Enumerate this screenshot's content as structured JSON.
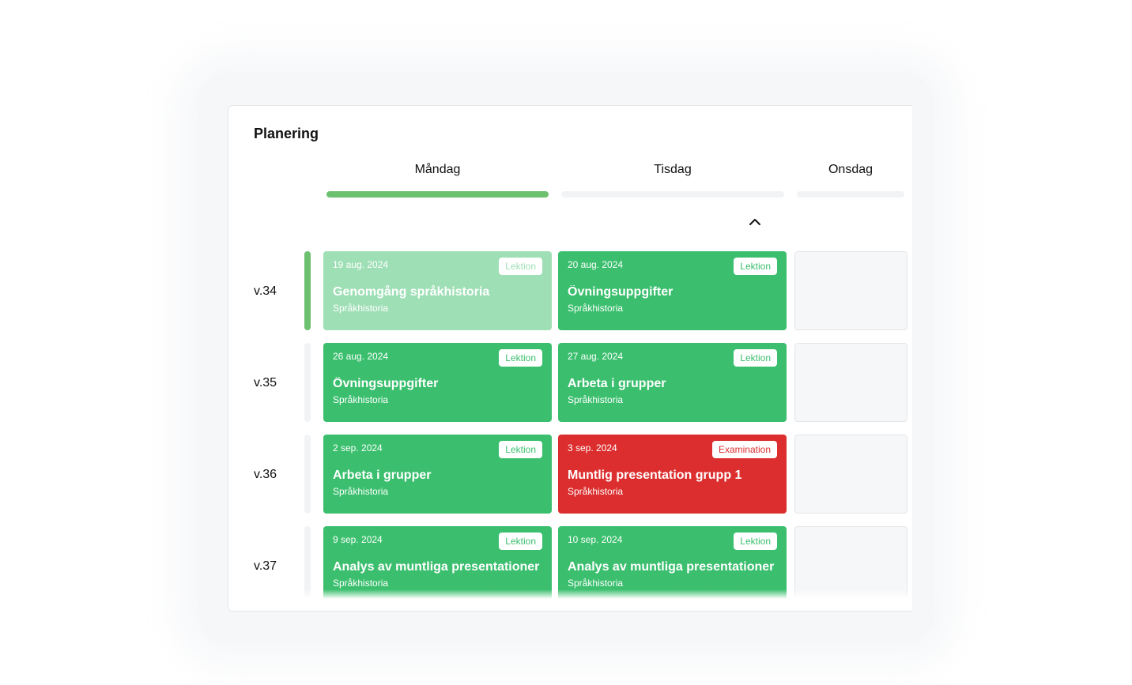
{
  "panel": {
    "title": "Planering"
  },
  "days": [
    {
      "label": "Måndag",
      "active": true
    },
    {
      "label": "Tisdag",
      "active": false
    },
    {
      "label": "Onsdag",
      "active": false
    }
  ],
  "colors": {
    "lesson": "#3bbf6e",
    "lesson_faded": "#9fdfb6",
    "exam": "#dc2e2e",
    "active_bar": "#6cc070"
  },
  "weeks": [
    {
      "label": "v.34",
      "active": true,
      "cards": [
        {
          "date": "19 aug. 2024",
          "badge": "Lektion",
          "title": "Genomgång språkhistoria",
          "subject": "Språkhistoria",
          "style": "faded"
        },
        {
          "date": "20 aug. 2024",
          "badge": "Lektion",
          "title": "Övningsuppgifter",
          "subject": "Språkhistoria",
          "style": "lesson"
        }
      ]
    },
    {
      "label": "v.35",
      "active": false,
      "cards": [
        {
          "date": "26 aug. 2024",
          "badge": "Lektion",
          "title": "Övningsuppgifter",
          "subject": "Språkhistoria",
          "style": "lesson"
        },
        {
          "date": "27 aug. 2024",
          "badge": "Lektion",
          "title": "Arbeta i grupper",
          "subject": "Språkhistoria",
          "style": "lesson"
        }
      ]
    },
    {
      "label": "v.36",
      "active": false,
      "cards": [
        {
          "date": "2 sep. 2024",
          "badge": "Lektion",
          "title": "Arbeta i grupper",
          "subject": "Språkhistoria",
          "style": "lesson"
        },
        {
          "date": "3 sep. 2024",
          "badge": "Examination",
          "title": "Muntlig presentation grupp 1",
          "subject": "Språkhistoria",
          "style": "exam"
        }
      ]
    },
    {
      "label": "v.37",
      "active": false,
      "cards": [
        {
          "date": "9 sep. 2024",
          "badge": "Lektion",
          "title": "Analys av muntliga presentationer",
          "subject": "Språkhistoria",
          "style": "lesson"
        },
        {
          "date": "10 sep. 2024",
          "badge": "Lektion",
          "title": "Analys av muntliga presentationer",
          "subject": "Språkhistoria",
          "style": "lesson"
        }
      ]
    }
  ],
  "icons": {
    "collapse": "chevron-up-icon"
  }
}
